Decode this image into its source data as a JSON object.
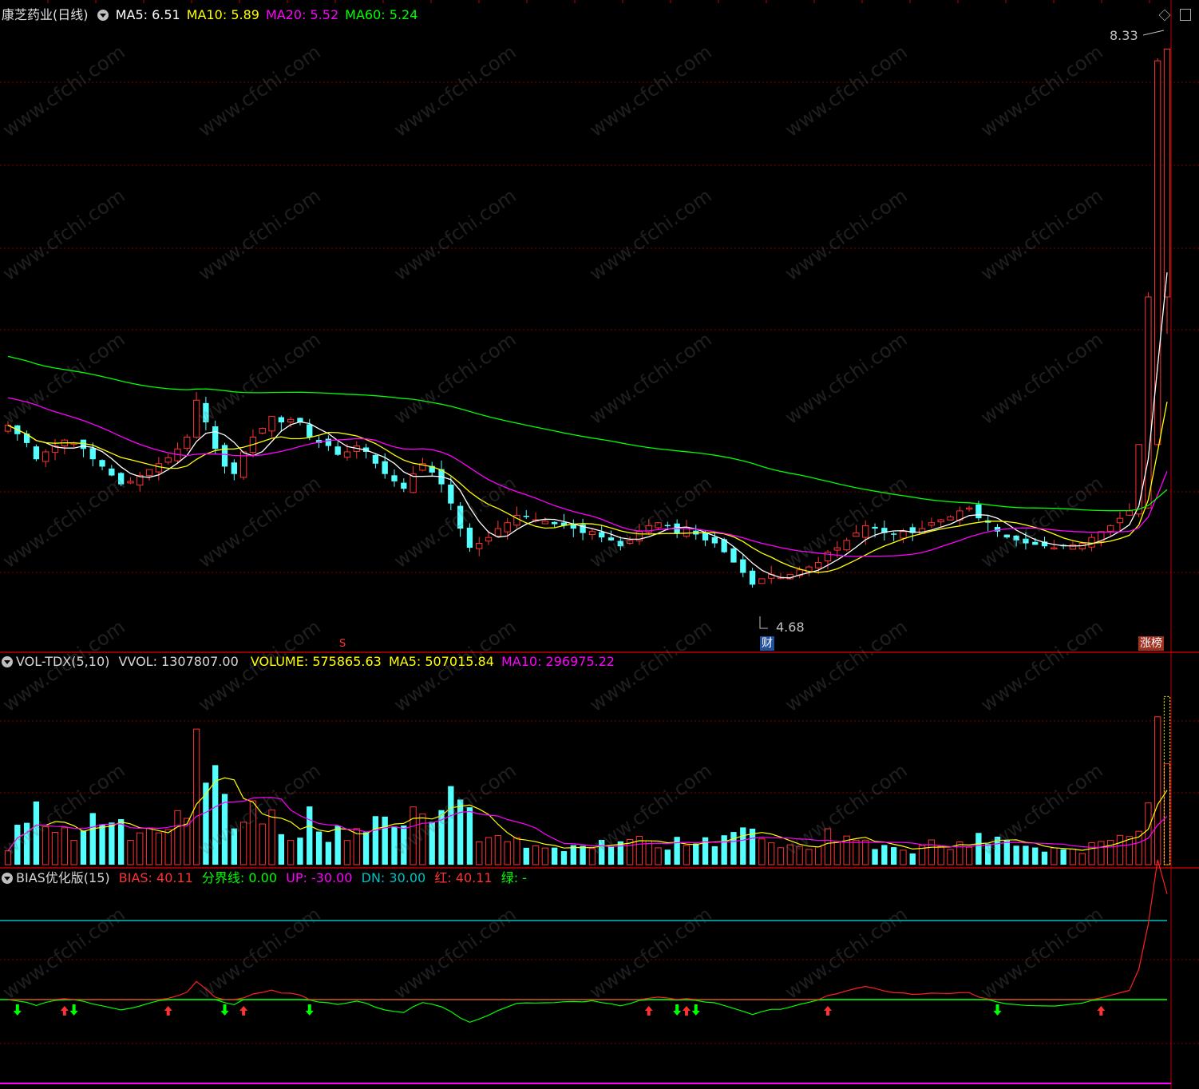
{
  "header": {
    "stock_name": "康芝药业",
    "period": "(日线)",
    "ma": [
      {
        "label": "MA5:",
        "value": "6.51",
        "color": "#ffffff"
      },
      {
        "label": "MA10:",
        "value": "5.89",
        "color": "#ffff00"
      },
      {
        "label": "MA20:",
        "value": "5.52",
        "color": "#ff00ff"
      },
      {
        "label": "MA60:",
        "value": "5.24",
        "color": "#00ff00"
      }
    ]
  },
  "vol_header": {
    "name": "VOL-TDX(5,10)",
    "vvol": "VVOL: 1307807.00",
    "volume": "VOLUME: 575865.63",
    "ma5": "MA5: 507015.84",
    "ma10": "MA10: 296975.22"
  },
  "bias_header": {
    "name": "BIAS优化版(15)",
    "bias": "BIAS: 40.11",
    "fenjie": "分界线: 0.00",
    "up": "UP: -30.00",
    "dn": "DN: 30.00",
    "hong": "红: 40.11",
    "lv": "绿: -"
  },
  "annotations": {
    "high_label": "8.33",
    "low_label": "4.68",
    "marker_s": "S",
    "tag_cai": "财",
    "tag_bang": "涨榜"
  },
  "watermark": "www.cfchi.com",
  "colors": {
    "up": "#ff3232",
    "down": "#54ffff",
    "ma5": "#ffffff",
    "ma10": "#ffff00",
    "ma20": "#ff00ff",
    "ma60": "#00ff00",
    "grid": "#800000",
    "panel_border": "#c00000",
    "bias_line": "#ff2020",
    "zero_line": "#00ff00",
    "dn_line": "#00c0c0"
  },
  "chart_data": [
    {
      "type": "candlestick",
      "title": "康芝药业(日线)",
      "price_high": 8.33,
      "price_low": 4.68,
      "ylim": [
        4.35,
        8.5
      ],
      "ma_latest": {
        "MA5": 6.51,
        "MA10": 5.89,
        "MA20": 5.52,
        "MA60": 5.24
      },
      "close": [
        5.78,
        5.72,
        5.66,
        5.55,
        5.6,
        5.64,
        5.68,
        5.66,
        5.62,
        5.55,
        5.5,
        5.44,
        5.38,
        5.4,
        5.44,
        5.48,
        5.52,
        5.56,
        5.62,
        5.7,
        5.95,
        5.8,
        5.62,
        5.5,
        5.45,
        5.6,
        5.7,
        5.76,
        5.84,
        5.8,
        5.82,
        5.8,
        5.7,
        5.66,
        5.64,
        5.58,
        5.6,
        5.64,
        5.6,
        5.52,
        5.45,
        5.4,
        5.35,
        5.45,
        5.52,
        5.46,
        5.38,
        5.25,
        5.08,
        4.95,
        4.98,
        5.02,
        5.08,
        5.12,
        5.17,
        5.16,
        5.14,
        5.13,
        5.11,
        5.1,
        5.08,
        5.05,
        5.06,
        5.02,
        5.0,
        4.96,
        5.0,
        5.06,
        5.1,
        5.12,
        5.1,
        5.05,
        5.08,
        5.04,
        5.0,
        4.98,
        4.92,
        4.85,
        4.78,
        4.7,
        4.74,
        4.77,
        4.75,
        4.77,
        4.8,
        4.82,
        4.85,
        4.92,
        4.95,
        5.0,
        5.05,
        5.1,
        5.08,
        5.05,
        5.04,
        5.06,
        5.05,
        5.08,
        5.12,
        5.14,
        5.16,
        5.2,
        5.22,
        5.15,
        5.12,
        5.06,
        5.02,
        5.0,
        4.98,
        4.97,
        4.96,
        4.95,
        4.96,
        4.97,
        4.98,
        5.02,
        5.06,
        5.1,
        5.15,
        5.2,
        5.65,
        6.65,
        8.25,
        8.33
      ],
      "volume_last": 1307807.0,
      "volume_ma5": 507015.84,
      "volume_ma10": 296975.22
    },
    {
      "type": "line",
      "title": "BIAS优化版(15)",
      "series": [
        {
          "name": "BIAS",
          "latest": 40.11
        }
      ],
      "reference_lines": {
        "分界线": 0.0,
        "UP": -30.0,
        "DN": 30.0
      }
    }
  ]
}
